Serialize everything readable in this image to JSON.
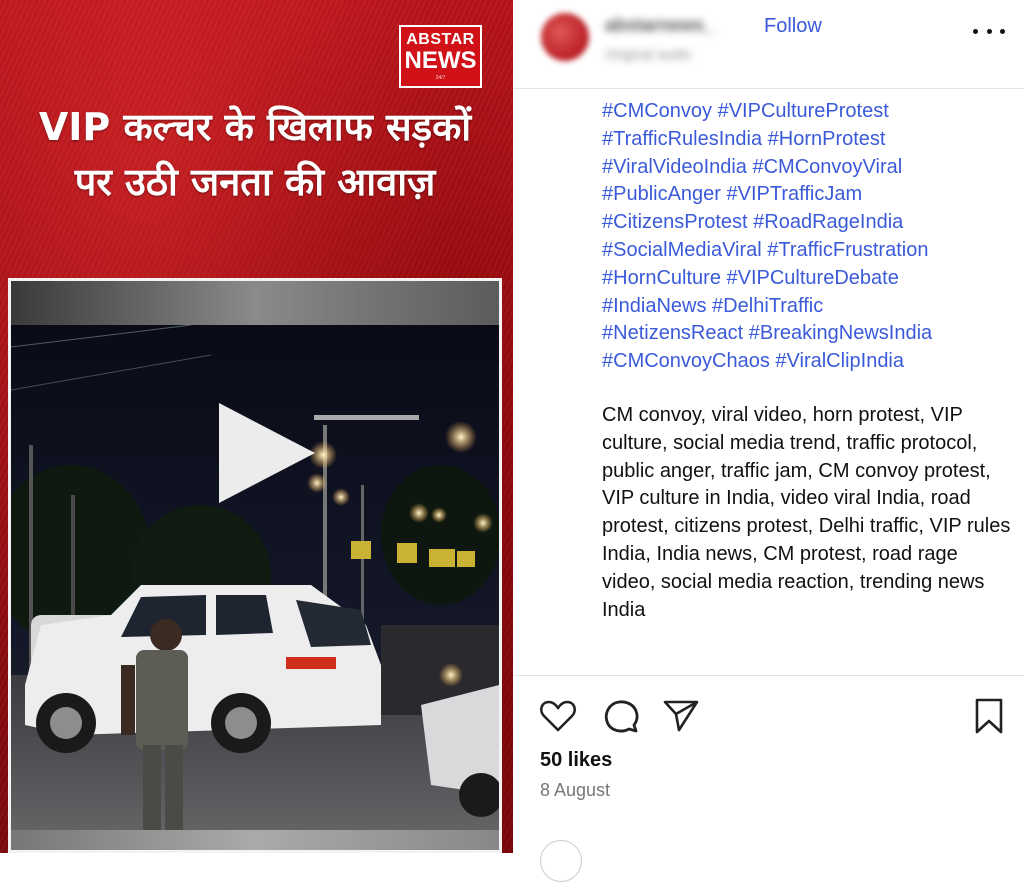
{
  "media": {
    "logo": {
      "top": "ABSTAR",
      "main": "NEWS",
      "foot": "24/7"
    },
    "headline": "VIP कल्चर के खिलाफ सड़कों पर उठी जनता की आवाज़",
    "play_icon": "play-icon"
  },
  "post": {
    "follow_label": "Follow",
    "more_icon": "more-options-icon",
    "hashtags": "#CMConvoy #VIPCultureProtest\n#TrafficRulesIndia #HornProtest\n#ViralVideoIndia #CMConvoyViral\n#PublicAnger #VIPTrafficJam\n#CitizensProtest #RoadRageIndia\n#SocialMediaViral #TrafficFrustration\n#HornCulture #VIPCultureDebate\n#IndiaNews #DelhiTraffic\n#NetizensReact #BreakingNewsIndia\n#CMConvoyChaos #ViralClipIndia",
    "keywords": "CM convoy, viral video, horn protest, VIP culture, social media trend, traffic protocol, public anger, traffic jam, CM convoy protest, VIP culture in India, video viral India, road protest, citizens protest, Delhi traffic, VIP rules India, India news, CM protest, road rage video, social media reaction, trending news India",
    "likes": "50 likes",
    "date": "8 August"
  },
  "colors": {
    "link": "#3a5ad9",
    "brand_red": "#d01218"
  },
  "icons": [
    "heart-icon",
    "comment-icon",
    "share-icon",
    "bookmark-icon"
  ]
}
